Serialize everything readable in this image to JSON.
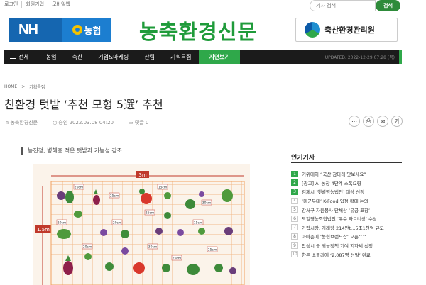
{
  "topbar": {
    "links": [
      "로그인",
      "회원가입",
      "모바일웹"
    ],
    "search_placeholder": "기사 검색",
    "search_button": "검색"
  },
  "header": {
    "ad_left": {
      "nh": "NH",
      "bank": "농협"
    },
    "site_title": "농축환경신문",
    "ad_right": "축산환경관리원"
  },
  "nav": {
    "items": [
      "전체",
      "농업",
      "축산",
      "기업&마케팅",
      "산림",
      "기획특집",
      "지면보기"
    ],
    "updated": "UPDATED. 2022-12-29 07:28 (목)"
  },
  "breadcrumb": {
    "home": "HOME",
    "separator": ">",
    "section": "기획특집"
  },
  "article": {
    "title": "친환경 텃밭 ‘추천 모형 5選’ 추천",
    "author": "농축환경신문",
    "date": "승인 2022.03.08 04:20",
    "comments": "댓글 0",
    "subtitle": "농진청, 병해충 적은 텃밭과 기능성 강조"
  },
  "share_icons": [
    "share-icon",
    "print-icon",
    "email-icon",
    "font-size-icon"
  ],
  "share_labels": [
    "⋯",
    "⎙",
    "✉",
    "가"
  ],
  "garden": {
    "dimension_width": "3m",
    "dimension_height": "1.5m",
    "labels": [
      "20cm",
      "25cm",
      "15cm",
      "30cm",
      "20cm",
      "20cm",
      "25cm",
      "15cm",
      "20cm",
      "30cm",
      "25cm",
      "20cm"
    ]
  },
  "sidebar": {
    "title": "인기기사",
    "items": [
      {
        "rank": "1",
        "text": "키위데이 “국산 참다래 맛보세요”"
      },
      {
        "rank": "2",
        "text": "[광고] AI 농장 4단계 소독요령"
      },
      {
        "rank": "3",
        "text": "김제시 ‘햇볕명농법인’ 대상 선정"
      },
      {
        "rank": "4",
        "text": "‘미군부대’ K-Food 입점 확대 논의"
      },
      {
        "rank": "5",
        "text": "강서구 자원봉사 단체상 ‘유공 표창’"
      },
      {
        "rank": "6",
        "text": "도일영농조합법인 ‘우수 파트너상’ 수상"
      },
      {
        "rank": "7",
        "text": "가락시장, 거래량 214만t…5조1천억 규모"
      },
      {
        "rank": "8",
        "text": "아마존에 ‘농협브랜드샵’ 오픈^^"
      },
      {
        "rank": "9",
        "text": "안성시 등 귀농정책 기여 지자체 선정"
      },
      {
        "rank": "10",
        "text": "한돈 소플리에 ‘2,087명 선발’ 완료"
      }
    ]
  }
}
